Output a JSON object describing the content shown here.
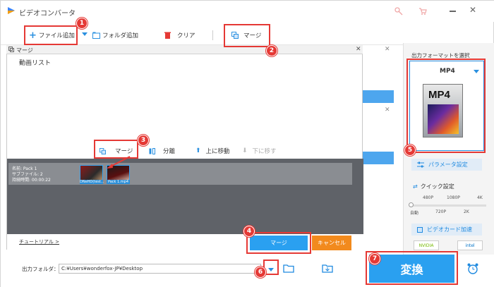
{
  "app": {
    "title": "ビデオコンバータ"
  },
  "toolbar": {
    "add_file": "ファイル追加",
    "add_folder": "フォルダ追加",
    "clear": "クリア",
    "merge": "マージ"
  },
  "dialog": {
    "title": "マージ",
    "list_label": "動画リスト",
    "actions": {
      "merge": "マージ",
      "split": "分離",
      "move_up": "上に移動",
      "move_down": "下に移す"
    },
    "pack": {
      "name": "名前: Pack 1",
      "subfiles": "サブファイル: 2",
      "duration": "持続時間: 00:00:22"
    },
    "thumbs": [
      "DNeHD(test...",
      "Pack 1.mp4"
    ],
    "tutorial": "チュートリアル >",
    "merge_button": "マージ",
    "cancel_button": "キャンセル"
  },
  "right_panel": {
    "format_header": "出力フォーマットを選択",
    "format_value": "MP4",
    "format_icon_text": "MP4",
    "param_settings": "パラメータ設定",
    "quick_settings": "クイック設定",
    "quality_top": [
      "480P",
      "1080P",
      "4K"
    ],
    "quality_bottom": [
      "自動",
      "720P",
      "2K"
    ],
    "gpu_accel": "ビデオカード加速",
    "gpu_chips": [
      "NVIDIA",
      "intel"
    ]
  },
  "bottom": {
    "output_label": "出力フォルダ：",
    "output_path": "C:¥Users¥wonderfox-JP¥Desktop",
    "convert": "変換"
  },
  "badges": [
    "1",
    "2",
    "3",
    "4",
    "5",
    "6",
    "7"
  ],
  "colors": {
    "accent": "#2aa0f0",
    "annotation": "#e53935",
    "cancel": "#f28a1d"
  }
}
